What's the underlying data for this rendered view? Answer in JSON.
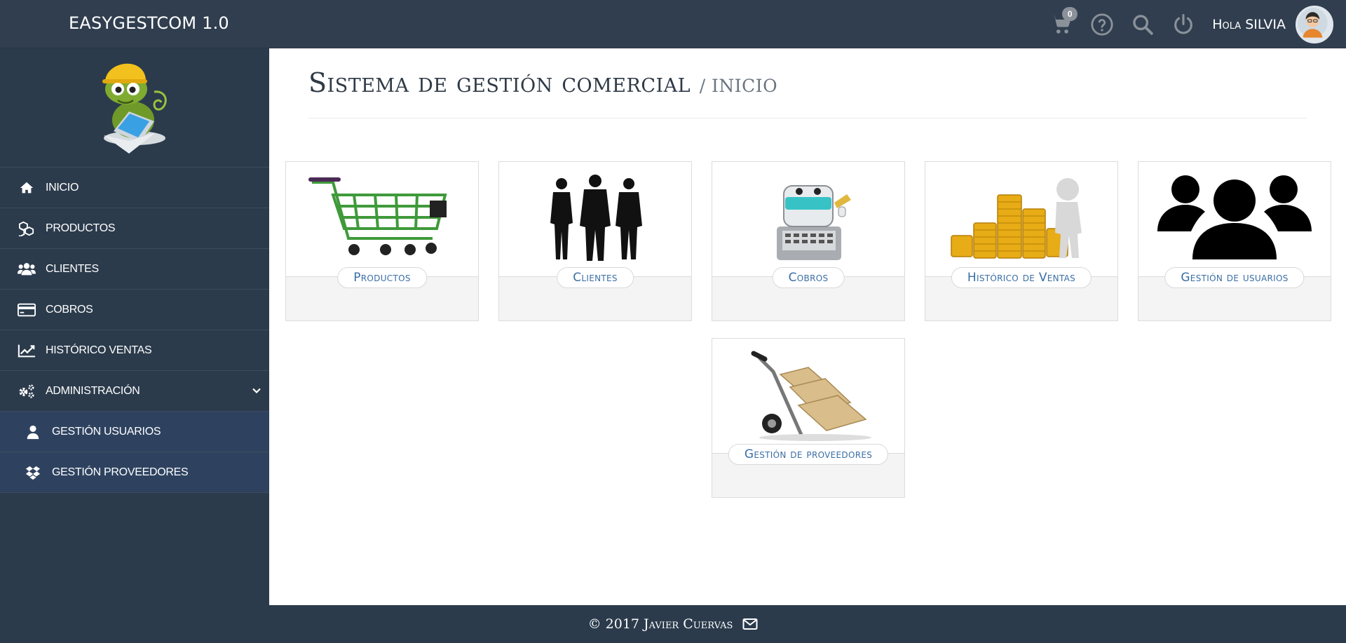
{
  "header": {
    "brand": "EASYGESTCOM 1.0",
    "cart_count": "0",
    "greeting": "Hola SILVIA",
    "icons": [
      "cart-icon",
      "help-icon",
      "search-icon",
      "power-icon"
    ]
  },
  "sidebar": {
    "items": [
      {
        "label": "INICIO",
        "icon": "home-icon"
      },
      {
        "label": "PRODUCTOS",
        "icon": "cubes-icon"
      },
      {
        "label": "CLIENTES",
        "icon": "users-icon"
      },
      {
        "label": "COBROS",
        "icon": "credit-card-icon"
      },
      {
        "label": "HISTÓRICO VENTAS",
        "icon": "line-chart-icon"
      },
      {
        "label": "ADMINISTRACIÓN",
        "icon": "cogs-icon"
      },
      {
        "label": "GESTIÓN USUARIOS",
        "icon": "user-icon"
      },
      {
        "label": "GESTIÓN PROVEEDORES",
        "icon": "dropbox-icon"
      }
    ]
  },
  "main": {
    "title": "Sistema de gestión comercial",
    "crumb": "/ INICIO",
    "tiles": [
      {
        "label": "Productos",
        "image": "shopping-cart-image"
      },
      {
        "label": "Clientes",
        "image": "business-people-image"
      },
      {
        "label": "Cobros",
        "image": "cash-register-image"
      },
      {
        "label": "Histórico de Ventas",
        "image": "gold-coins-image"
      },
      {
        "label": "Gestión de usuarios",
        "image": "user-group-image"
      },
      {
        "label": "Gestión de proveedores",
        "image": "hand-truck-image"
      }
    ]
  },
  "footer": {
    "text": "© 2017 Javier Cuervas",
    "icon": "envelope-icon"
  },
  "colors": {
    "sidebar_bg": "#2b3b4c",
    "submenu_bg": "#2e4260",
    "tile_label": "#3a6ea5",
    "main_bg": "#ffffff"
  }
}
